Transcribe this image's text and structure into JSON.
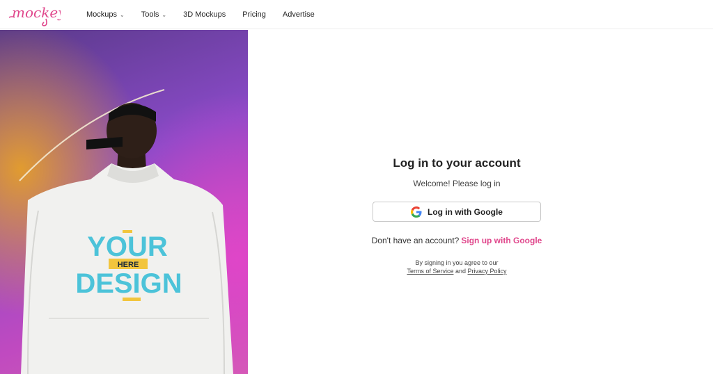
{
  "brand": {
    "logo_text": "mockey",
    "accent": "#e0478c"
  },
  "nav": {
    "items": [
      {
        "label": "Mockups",
        "has_dropdown": true,
        "icon": "chevron-down-icon"
      },
      {
        "label": "Tools",
        "has_dropdown": true,
        "icon": "chevron-down-icon"
      },
      {
        "label": "3D Mockups",
        "has_dropdown": false
      },
      {
        "label": "Pricing",
        "has_dropdown": false
      },
      {
        "label": "Advertise",
        "has_dropdown": false
      }
    ]
  },
  "hero": {
    "shirt_print": {
      "line1": "YOUR",
      "badge": "HERE",
      "line2": "DESIGN"
    },
    "colors": {
      "print": "#4cc3d9",
      "badge": "#f2c53d"
    }
  },
  "login": {
    "title": "Log in to your account",
    "subtitle": "Welcome! Please log in",
    "google_button": "Log in with Google",
    "google_icon": "google-g-icon",
    "signup_prompt": "Don't have an account?",
    "signup_link": "Sign up with Google",
    "terms_prefix": "By signing in you agree to our",
    "terms_link": "Terms of Service",
    "terms_and": "and",
    "privacy_link": "Privacy Policy"
  }
}
